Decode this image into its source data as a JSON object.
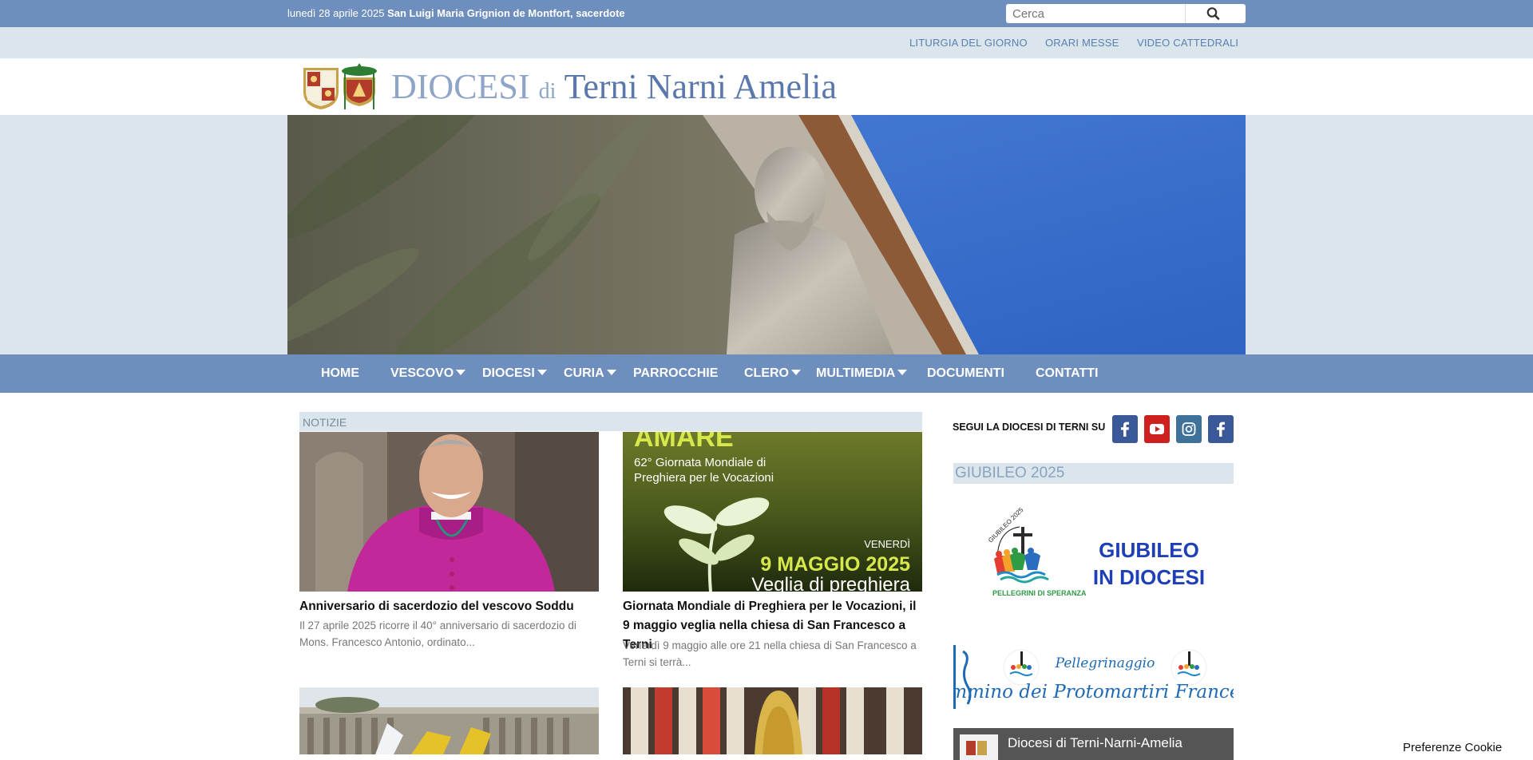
{
  "topbar": {
    "date": "lunedì 28 aprile 2025",
    "saint": "San Luigi Maria Grignion de Montfort, sacerdote",
    "search_placeholder": "Cerca"
  },
  "subnav": {
    "items": [
      "LITURGIA DEL GIORNO",
      "ORARI MESSE",
      "VIDEO CATTEDRALI"
    ]
  },
  "logo": {
    "diocesi": "DIOCESI",
    "di": "di",
    "name": "Terni Narni Amelia"
  },
  "mainnav": {
    "items": [
      {
        "label": "HOME",
        "dropdown": false
      },
      {
        "label": "VESCOVO",
        "dropdown": true
      },
      {
        "label": "DIOCESI",
        "dropdown": true
      },
      {
        "label": "CURIA",
        "dropdown": true
      },
      {
        "label": "PARROCCHIE",
        "dropdown": false
      },
      {
        "label": "CLERO",
        "dropdown": true
      },
      {
        "label": "MULTIMEDIA",
        "dropdown": true
      },
      {
        "label": "DOCUMENTI",
        "dropdown": false
      },
      {
        "label": "CONTATTI",
        "dropdown": false
      }
    ]
  },
  "news": {
    "heading": "NOTIZIE",
    "articles": [
      {
        "title": "Anniversario di sacerdozio del vescovo Soddu",
        "excerpt": "Il 27 aprile 2025 ricorre il 40° anniversario di sacerdozio di Mons. Francesco Antonio, ordinato..."
      },
      {
        "title": "Giornata Mondiale di Preghiera per le Vocazioni, il 9 maggio veglia nella chiesa di San Francesco a Terni",
        "excerpt": "Venerdì 9 maggio alle ore 21 nella chiesa di San Francesco a Terni si terrà...",
        "image_text": {
          "top": "AMARE",
          "line1": "62° Giornata Mondiale di",
          "line2": "Preghiera per le Vocazioni",
          "day": "VENERDÌ",
          "date": "9 MAGGIO 2025",
          "event": "Veglia di preghiera"
        }
      }
    ]
  },
  "sidebar": {
    "follow_label": "SEGUI LA DIOCESI DI TERNI SU",
    "social": [
      {
        "icon": "facebook-icon",
        "color": "#3b5998"
      },
      {
        "icon": "youtube-icon",
        "color": "#cd201f"
      },
      {
        "icon": "instagram-icon",
        "color": "#3f729b"
      },
      {
        "icon": "facebook-icon",
        "color": "#3b5998"
      }
    ],
    "giubileo_heading": "GIUBILEO 2025",
    "giubileo_banner": {
      "ring_top": "GIUBILEO 2025",
      "ring_bottom": "PELLEGRINI DI SPERANZA",
      "line1": "GIUBILEO",
      "line2": "IN DIOCESI"
    },
    "pilgrimage_banner": {
      "line1": "Pellegrinaggio",
      "line2": "Cammino dei Protomartiri Francescani"
    },
    "video_channel": "Diocesi di Terni-Narni-Amelia"
  },
  "cookie": "Preferenze Cookie",
  "colors": {
    "primary": "#6e8fbd",
    "light": "#dae5ec",
    "link": "#5a7fb3"
  }
}
